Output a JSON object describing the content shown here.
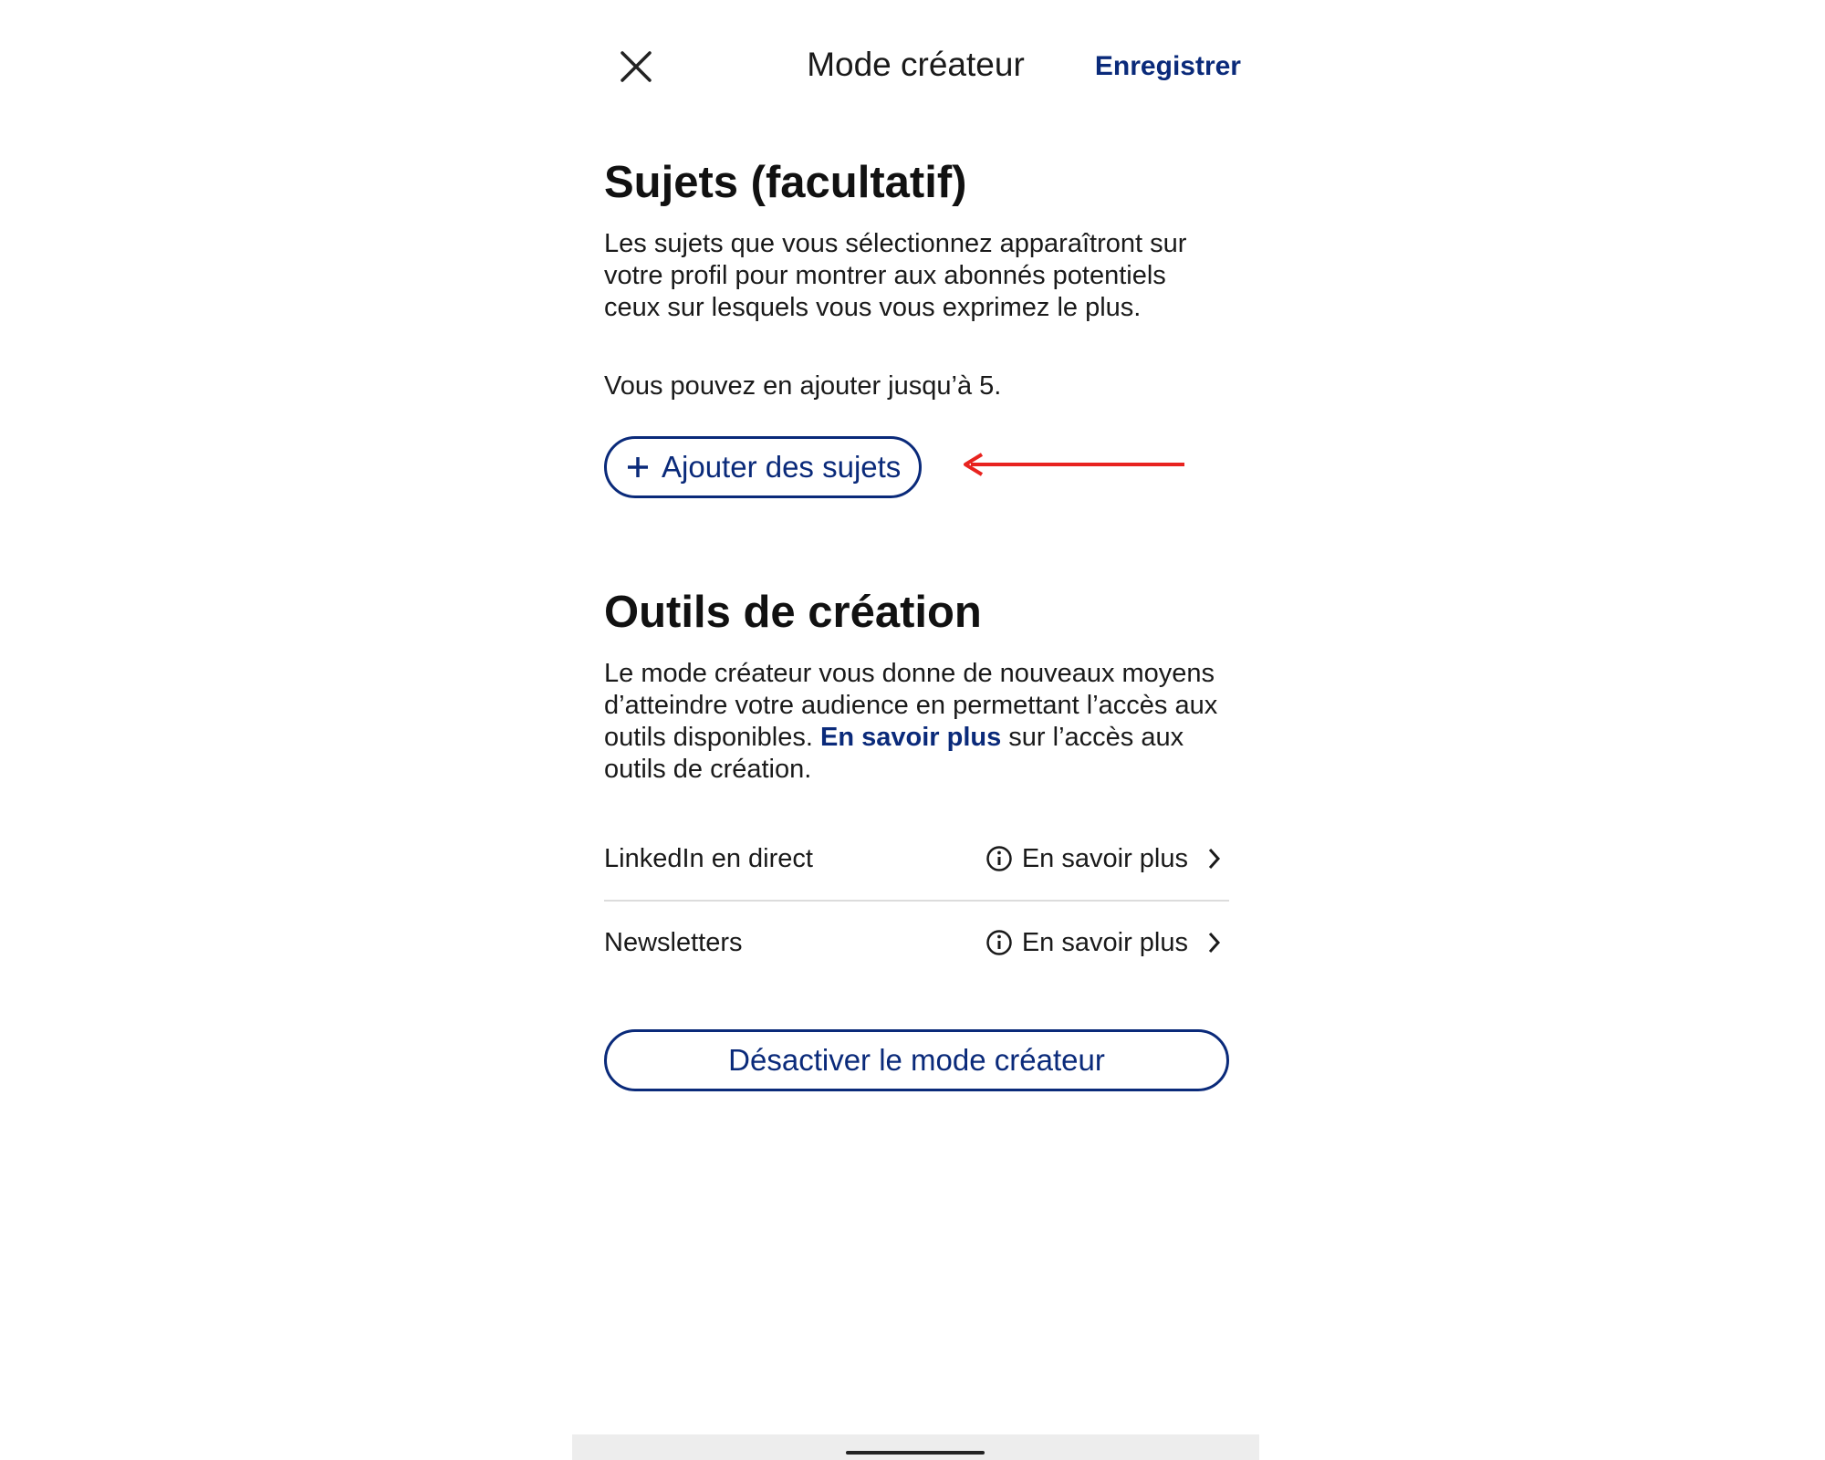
{
  "header": {
    "title": "Mode créateur",
    "save_label": "Enregistrer",
    "close_icon": "close-icon"
  },
  "topics": {
    "title": "Sujets (facultatif)",
    "description": "Les sujets que vous sélectionnez apparaîtront sur votre profil pour montrer aux abonnés potentiels ceux sur lesquels vous vous exprimez le plus.",
    "limit_text": "Vous pouvez en ajouter jusqu’à 5.",
    "add_button_label": "Ajouter des sujets"
  },
  "tools": {
    "title": "Outils de création",
    "description_before": "Le mode créateur vous donne de nouveaux moyens d’atteindre votre audience en permettant l’accès aux outils disponibles.",
    "description_link": "En savoir plus",
    "description_after": "sur l’accès aux outils de création.",
    "items": [
      {
        "label": "LinkedIn en direct",
        "action": "En savoir plus"
      },
      {
        "label": "Newsletters",
        "action": "En savoir plus"
      }
    ]
  },
  "deactivate_label": "Désactiver le mode créateur",
  "colors": {
    "accent": "#0a2a7a",
    "annotation_arrow": "#e8231f"
  }
}
